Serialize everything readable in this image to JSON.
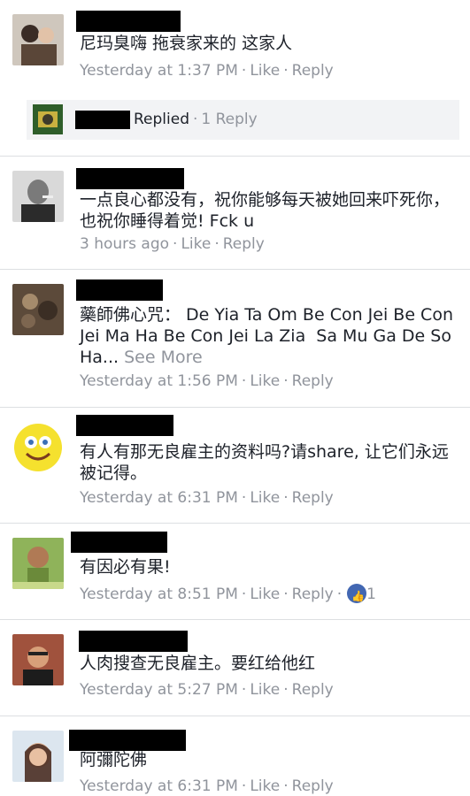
{
  "comments": [
    {
      "text": "尼玛臭嗨 拖衰家来的 这家人",
      "time": "Yesterday at 1:37 PM",
      "like": "Like",
      "reply": "Reply"
    },
    {
      "text": "一点良心都没有，祝你能够每天被她回来吓死你，也祝你睡得着觉! Fck u",
      "time": "3 hours ago",
      "like": "Like",
      "reply": "Reply"
    },
    {
      "text": "藥師佛心咒： De Yia Ta Om Be Con Jei Be Con Jei Ma Ha Be Con Jei La Zia  Sa Mu Ga De So Ha...",
      "see_more": "See More",
      "time": "Yesterday at 1:56 PM",
      "like": "Like",
      "reply": "Reply"
    },
    {
      "text": "有人有那无良雇主的资料吗?请share, 让它们永远被记得。",
      "time": "Yesterday at 6:31 PM",
      "like": "Like",
      "reply": "Reply"
    },
    {
      "text": "有因必有果!",
      "time": "Yesterday at 8:51 PM",
      "like": "Like",
      "reply": "Reply",
      "reactions": "1"
    },
    {
      "text": "人肉搜查无良雇主。要红给他红",
      "time": "Yesterday at 5:27 PM",
      "like": "Like",
      "reply": "Reply"
    },
    {
      "text": "阿彌陀佛",
      "time": "Yesterday at 6:31 PM",
      "like": "Like",
      "reply": "Reply"
    }
  ],
  "reply_summary": {
    "label": "Replied",
    "count": "1 Reply"
  },
  "colors": {
    "meta": "#90949c",
    "like_badge": "#4267b2",
    "reply_bg": "#f2f3f5"
  }
}
